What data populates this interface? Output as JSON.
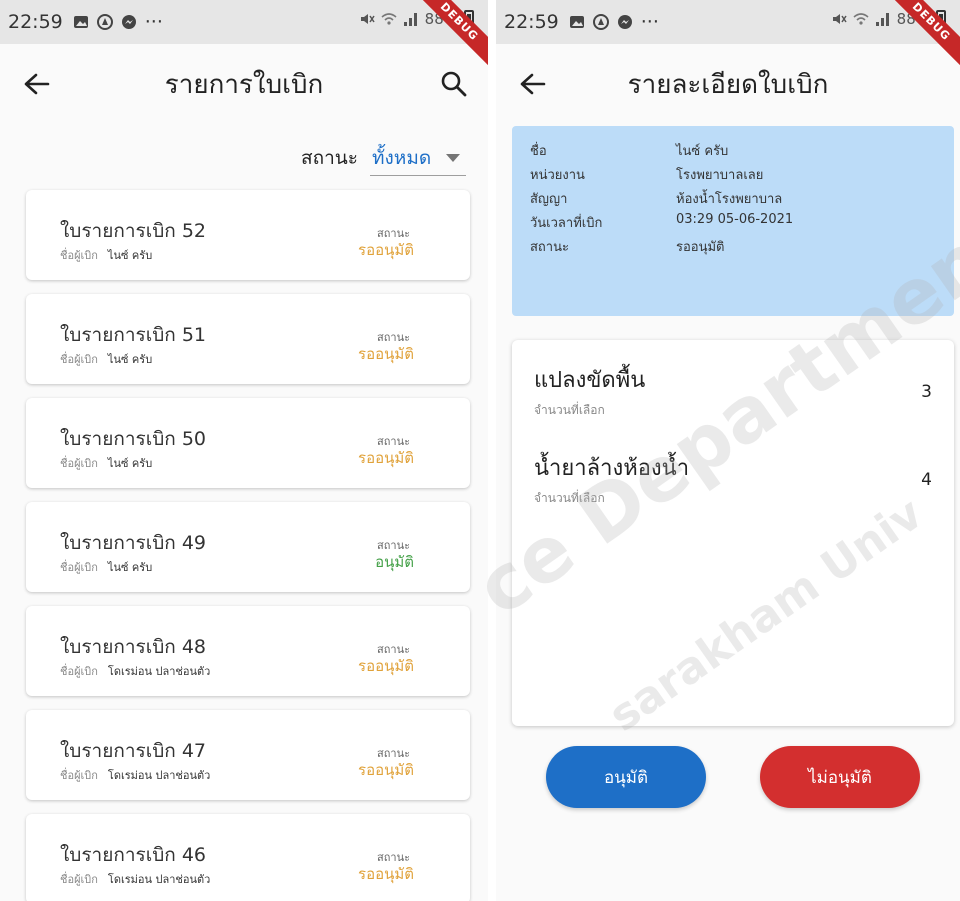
{
  "left": {
    "status_time": "22:59",
    "status_battery": "88%",
    "debug_label": "DEBUG",
    "title": "รายการใบเบิก",
    "filter_label": "สถานะ",
    "filter_value": "ทั้งหมด",
    "status_label": "สถานะ",
    "requester_label": "ชื่อผู้เบิก",
    "items": [
      {
        "title": "ใบรายการเบิก 52",
        "requester": "ไนซ์ ครับ",
        "status": "รออนุมัติ",
        "status_color": "#e0a23a"
      },
      {
        "title": "ใบรายการเบิก 51",
        "requester": "ไนซ์ ครับ",
        "status": "รออนุมัติ",
        "status_color": "#e0a23a"
      },
      {
        "title": "ใบรายการเบิก 50",
        "requester": "ไนซ์ ครับ",
        "status": "รออนุมัติ",
        "status_color": "#e0a23a"
      },
      {
        "title": "ใบรายการเบิก 49",
        "requester": "ไนซ์ ครับ",
        "status": "อนุมัติ",
        "status_color": "#43a047"
      },
      {
        "title": "ใบรายการเบิก 48",
        "requester": "โดเรม่อน ปลาช่อนตัว",
        "status": "รออนุมัติ",
        "status_color": "#e0a23a"
      },
      {
        "title": "ใบรายการเบิก 47",
        "requester": "โดเรม่อน ปลาช่อนตัว",
        "status": "รออนุมัติ",
        "status_color": "#e0a23a"
      },
      {
        "title": "ใบรายการเบิก 46",
        "requester": "โดเรม่อน ปลาช่อนตัว",
        "status": "รออนุมัติ",
        "status_color": "#e0a23a"
      }
    ]
  },
  "right": {
    "status_time": "22:59",
    "status_battery": "88%",
    "debug_label": "DEBUG",
    "title": "รายละเอียดใบเบิก",
    "info": [
      {
        "key": "ชื่อ",
        "value": "ไนซ์ ครับ"
      },
      {
        "key": "หน่วยงาน",
        "value": "โรงพยาบาลเลย"
      },
      {
        "key": "สัญญา",
        "value": "ห้องน้ำโรงพยาบาล"
      },
      {
        "key": "วันเวลาที่เบิก",
        "value": "03:29 05-06-2021"
      },
      {
        "key": "สถานะ",
        "value": "รออนุมัติ"
      }
    ],
    "items": [
      {
        "name": "แปลงขัดพื้น",
        "sub": "จำนวนที่เลือก",
        "qty": "3"
      },
      {
        "name": "น้ำยาล้างห้องน้ำ",
        "sub": "จำนวนที่เลือก",
        "qty": "4"
      }
    ],
    "approve_label": "อนุมัติ",
    "reject_label": "ไม่อนุมัติ"
  },
  "watermark": {
    "line1": "ce Department",
    "line2": "sarakham Univ"
  },
  "colors": {
    "accent": "#1e6fc7",
    "danger": "#d32f2f",
    "pending": "#e0a23a",
    "approved": "#43a047",
    "info_panel": "#bcdcf8"
  },
  "icons": [
    "back-arrow-icon",
    "search-icon",
    "dropdown-icon",
    "gallery-icon",
    "drive-icon",
    "messenger-icon",
    "wifi-icon",
    "signal-icon",
    "battery-icon",
    "mute-icon"
  ]
}
